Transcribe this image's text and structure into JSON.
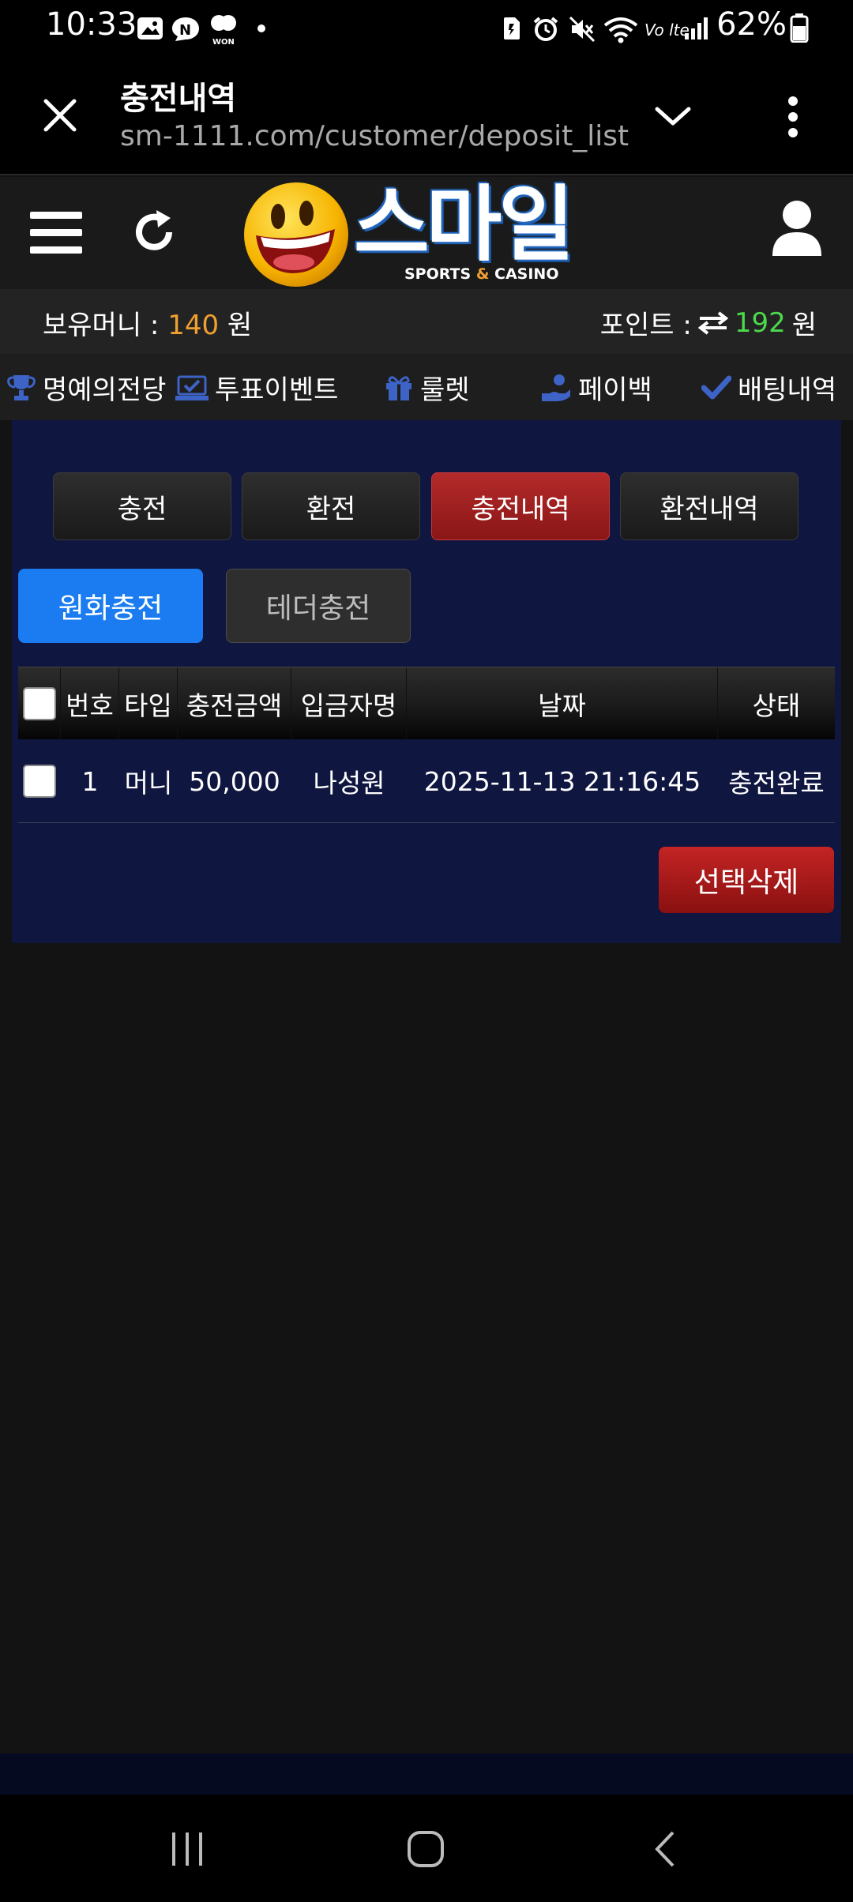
{
  "status_bar": {
    "time": "10:33",
    "battery": "62%",
    "left_icons": [
      "gallery-icon",
      "naver-icon",
      "won-icon",
      "dot-icon"
    ],
    "right_icons": [
      "sim-icon",
      "alarm-icon",
      "mute-icon",
      "wifi-icon",
      "volte-icon",
      "signal-icon",
      "battery-icon"
    ],
    "won_label": "WON",
    "volte_label": "Vo lte"
  },
  "browser": {
    "title": "충전내역",
    "url": "sm-1111.com/customer/deposit_list"
  },
  "site": {
    "logo_text": "스마일",
    "logo_tagline_left": "SPORTS",
    "logo_tagline_amp": "&",
    "logo_tagline_right": "CASINO"
  },
  "balance": {
    "money_label": "보유머니 :",
    "money_value": "140",
    "money_unit": "원",
    "point_label": "포인트 :",
    "point_value": "192",
    "point_unit": "원"
  },
  "nav": {
    "items": [
      {
        "label": "명예의전당",
        "icon": "trophy-icon"
      },
      {
        "label": "투표이벤트",
        "icon": "vote-icon"
      },
      {
        "label": "룰렛",
        "icon": "gift-icon"
      },
      {
        "label": "페이백",
        "icon": "payback-icon"
      },
      {
        "label": "배팅내역",
        "icon": "check-icon"
      }
    ]
  },
  "tabs": {
    "deposit": "충전",
    "withdraw": "환전",
    "deposit_history": "충전내역",
    "withdraw_history": "환전내역",
    "active": "충전내역"
  },
  "sub_tabs": {
    "krw": "원화충전",
    "tether": "테더충전",
    "active": "원화충전"
  },
  "table": {
    "headers": [
      "번호",
      "타입",
      "충전금액",
      "입금자명",
      "날짜",
      "상태"
    ],
    "rows": [
      {
        "no": "1",
        "type": "머니",
        "amount": "50,000",
        "depositor": "나성원",
        "date": "2025-11-13 21:16:45",
        "status": "충전완료"
      }
    ]
  },
  "actions": {
    "delete_selected": "선택삭제"
  },
  "colors": {
    "money_orange": "#f0a030",
    "point_green": "#4cd94c",
    "active_tab_red": "#a81e1e",
    "active_sub_blue": "#1a7cf0",
    "content_navy": "#0f1640"
  }
}
